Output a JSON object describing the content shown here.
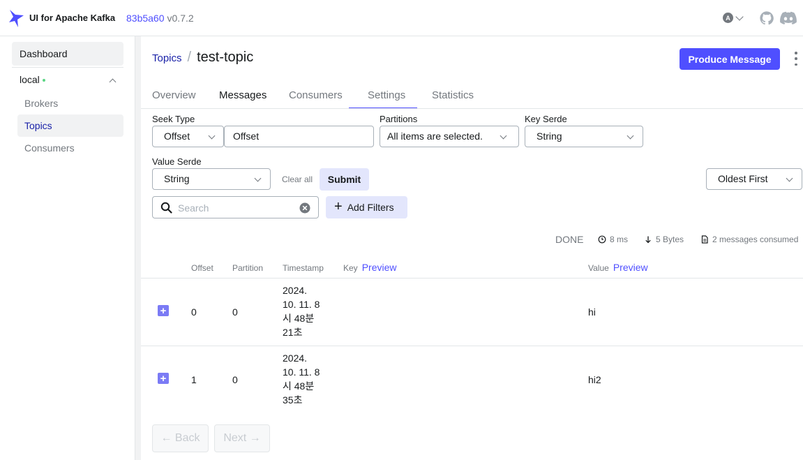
{
  "header": {
    "brand": "UI for Apache Kafka",
    "commit": "83b5a60",
    "version": "v0.7.2",
    "user_initial": "A"
  },
  "sidebar": {
    "dashboard": "Dashboard",
    "cluster": "local",
    "items": [
      {
        "label": "Brokers",
        "active": false
      },
      {
        "label": "Topics",
        "active": true
      },
      {
        "label": "Consumers",
        "active": false
      }
    ]
  },
  "breadcrumb": {
    "parent": "Topics",
    "separator": "/",
    "current": "test-topic"
  },
  "actions": {
    "produce": "Produce Message"
  },
  "tabs": [
    "Overview",
    "Messages",
    "Consumers",
    "Settings",
    "Statistics"
  ],
  "active_tab": "Messages",
  "filters": {
    "seek_type_label": "Seek Type",
    "seek_type_value": "Offset",
    "seek_input_value": "Offset",
    "partitions_label": "Partitions",
    "partitions_value": "All items are selected.",
    "key_serde_label": "Key Serde",
    "key_serde_value": "String",
    "value_serde_label": "Value Serde",
    "value_serde_value": "String",
    "clear_all": "Clear all",
    "submit": "Submit",
    "order_value": "Oldest First",
    "search_placeholder": "Search",
    "add_filters": "Add Filters"
  },
  "stats": {
    "status": "DONE",
    "elapsed": "8 ms",
    "bytes": "5 Bytes",
    "consumed": "2 messages consumed"
  },
  "table": {
    "columns": {
      "offset": "Offset",
      "partition": "Partition",
      "timestamp": "Timestamp",
      "key": "Key",
      "key_preview": "Preview",
      "value": "Value",
      "value_preview": "Preview"
    },
    "rows": [
      {
        "offset": "0",
        "partition": "0",
        "ts": [
          "2024.",
          "10. 11. 8",
          "시 48분",
          "21초"
        ],
        "value": "hi"
      },
      {
        "offset": "1",
        "partition": "0",
        "ts": [
          "2024.",
          "10. 11. 8",
          "시 48분",
          "35초"
        ],
        "value": "hi2"
      }
    ]
  },
  "pagination": {
    "back": "← Back",
    "next": "Next →"
  },
  "colors": {
    "accent": "#4f4fff",
    "link": "#1a22a8",
    "online": "#5cd685"
  }
}
